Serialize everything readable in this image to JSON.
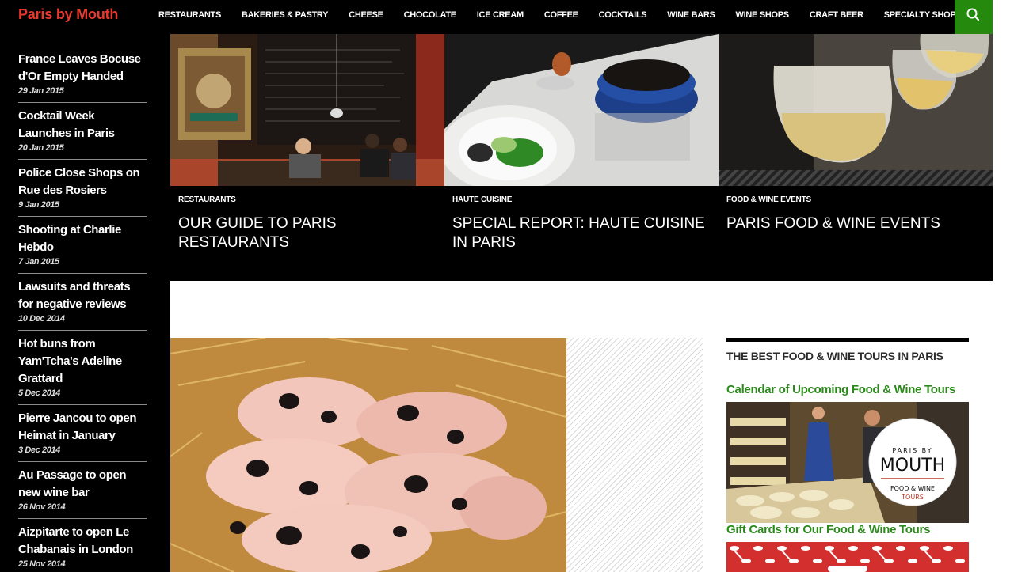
{
  "site": {
    "logo": "Paris by Mouth"
  },
  "nav": {
    "items": [
      "RESTAURANTS",
      "BAKERIES & PASTRY",
      "CHEESE",
      "CHOCOLATE",
      "ICE CREAM",
      "COFFEE",
      "COCKTAILS",
      "WINE BARS",
      "WINE SHOPS",
      "CRAFT BEER",
      "SPECIALTY SHOPS"
    ],
    "search_icon": "search-icon"
  },
  "sidebar": {
    "posts": [
      {
        "title": "France Leaves Bocuse d'Or Empty Handed",
        "date": "29 Jan 2015"
      },
      {
        "title": "Cocktail Week Launches in Paris",
        "date": "20 Jan 2015"
      },
      {
        "title": "Police Close Shops on Rue des Rosiers",
        "date": "9 Jan 2015"
      },
      {
        "title": "Shooting at Charlie Hebdo",
        "date": "7 Jan 2015"
      },
      {
        "title": "Lawsuits and threats for negative reviews",
        "date": "10 Dec 2014"
      },
      {
        "title": "Hot buns from Yam'Tcha's Adeline Grattard",
        "date": "5 Dec 2014"
      },
      {
        "title": "Pierre Jancou to open Heimat in January",
        "date": "3 Dec 2014"
      },
      {
        "title": "Au Passage to open new wine bar",
        "date": "26 Nov 2014"
      },
      {
        "title": "Aizpitarte to open Le Chabanais in London",
        "date": "25 Nov 2014"
      }
    ]
  },
  "featured": [
    {
      "category": "RESTAURANTS",
      "title": "OUR GUIDE TO PARIS RESTAURANTS"
    },
    {
      "category": "HAUTE CUISINE",
      "title": "SPECIAL REPORT: HAUTE CUISINE IN PARIS"
    },
    {
      "category": "FOOD & WINE EVENTS",
      "title": "PARIS FOOD & WINE EVENTS"
    }
  ],
  "widget": {
    "title": "THE BEST FOOD & WINE TOURS IN PARIS",
    "calendar_link": "Calendar of Upcoming Food & Wine Tours",
    "badge": {
      "line1": "PARIS BY",
      "line2": "MOUTH",
      "line3": "FOOD & WINE",
      "line4": "TOURS"
    },
    "gift_link": "Gift Cards for Our Food & Wine Tours"
  },
  "colors": {
    "accent_green": "#24890d",
    "logo_red": "#e8392f",
    "link_green": "#2a8a1a"
  }
}
